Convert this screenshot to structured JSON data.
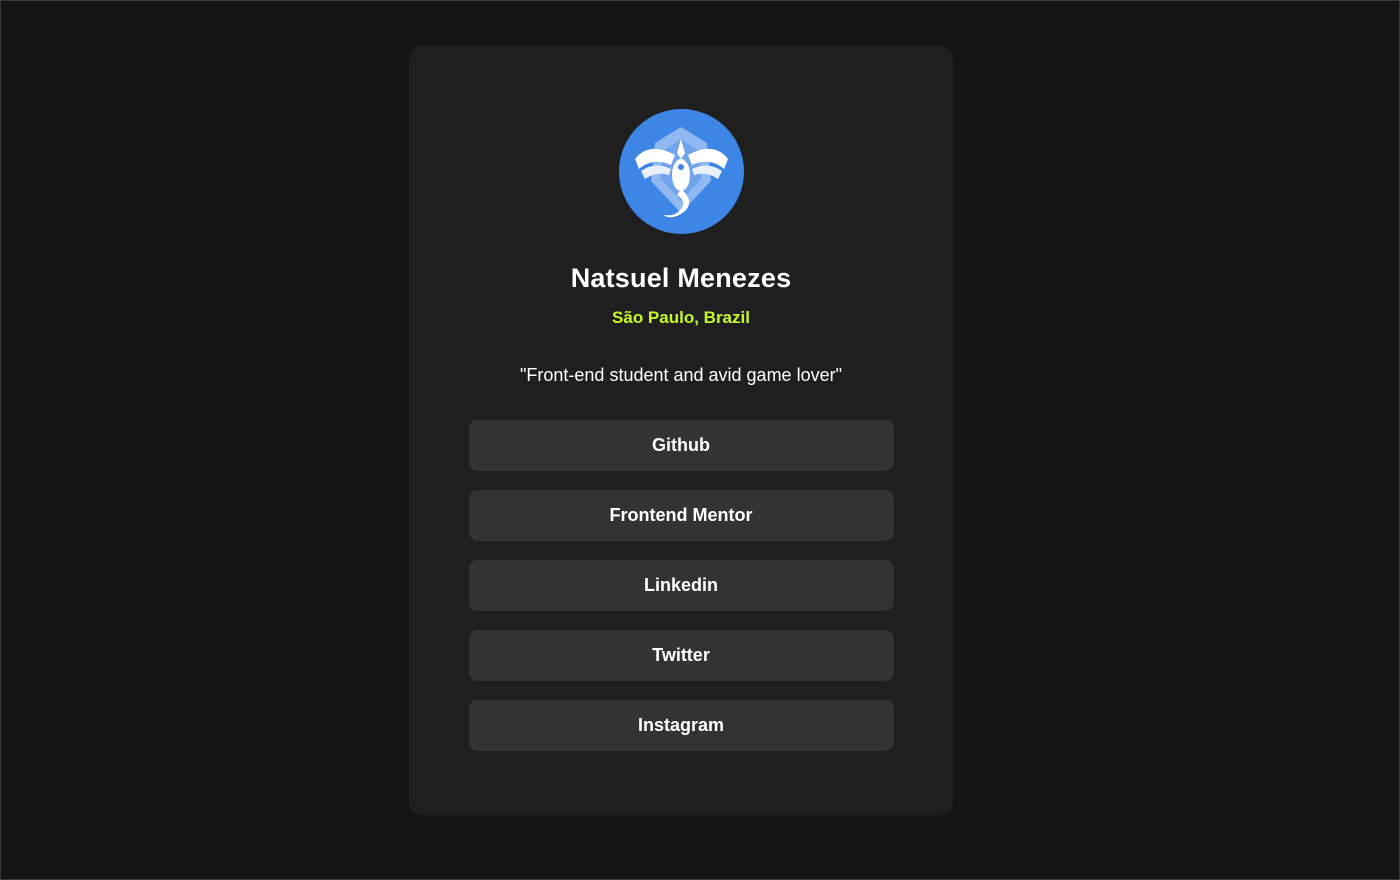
{
  "profile": {
    "name": "Natsuel Menezes",
    "location": "São Paulo, Brazil",
    "bio": "\"Front-end student and avid game lover\"",
    "avatar_icon": "lugia-emblem-icon"
  },
  "links": [
    {
      "label": "Github"
    },
    {
      "label": "Frontend Mentor"
    },
    {
      "label": "Linkedin"
    },
    {
      "label": "Twitter"
    },
    {
      "label": "Instagram"
    }
  ],
  "colors": {
    "page_background": "#141414",
    "card_background": "#1f1f1f",
    "button_background": "#333333",
    "accent": "#c5f82a",
    "avatar_background": "#3d86e6"
  }
}
